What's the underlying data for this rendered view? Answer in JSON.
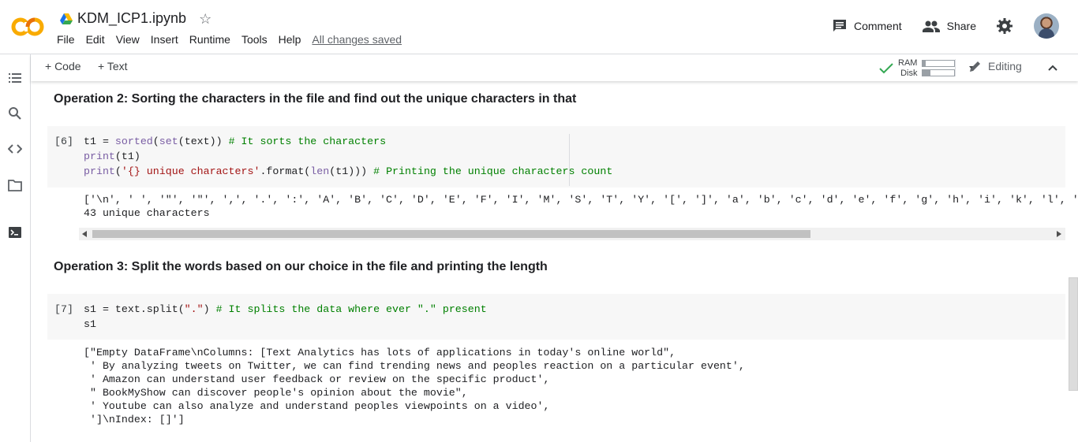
{
  "app": {
    "logo_text": "CO",
    "notebook_title": "KDM_ICP1.ipynb"
  },
  "menu": [
    "File",
    "Edit",
    "View",
    "Insert",
    "Runtime",
    "Tools",
    "Help"
  ],
  "saved_status": "All changes saved",
  "header_actions": {
    "comment": "Comment",
    "share": "Share"
  },
  "toolbar": {
    "add_code": "+ Code",
    "add_text": "+ Text",
    "ram_label": "RAM",
    "disk_label": "Disk",
    "ram_usage": 0.08,
    "disk_usage": 0.25,
    "editing_label": "Editing"
  },
  "cells": {
    "text1": "Operation 2: Sorting the characters in the file and find out the unique characters in that",
    "code1": {
      "exec_count": "[6]",
      "output_line1": "['\\n', ' ', '\"', '\"', ',', '.', ':', 'A', 'B', 'C', 'D', 'E', 'F', 'I', 'M', 'S', 'T', 'Y', '[', ']', 'a', 'b', 'c', 'd', 'e', 'f', 'g', 'h', 'i', 'k', 'l', 'm', 'n',",
      "output_line2": "43 unique characters"
    },
    "text2": "Operation 3: Split the words based on our choice in the file and printing the length",
    "code2": {
      "exec_count": "[7]",
      "output_lines": [
        "[\"Empty DataFrame\\nColumns: [Text Analytics has lots of applications in today's online world\",",
        " ' By analyzing tweets on Twitter, we can find trending news and peoples reaction on a particular event',",
        " ' Amazon can understand user feedback or review on the specific product',",
        " \" BookMyShow can discover people's opinion about the movie\",",
        " ' Youtube can also analyze and understand peoples viewpoints on a video',",
        " ']\\nIndex: []']"
      ]
    }
  },
  "colors": {
    "logo_orange": "#f9ab00",
    "comment_green": "#008000",
    "keyword_purple": "#795da3",
    "string_red": "#a31515",
    "check_green": "#34a853"
  }
}
